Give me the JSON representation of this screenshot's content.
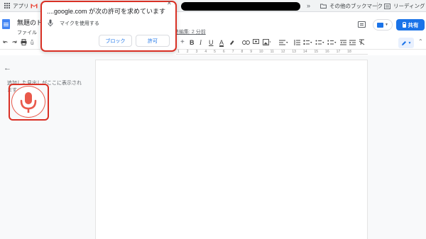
{
  "bookmarks": {
    "apps_label": "アプリ",
    "chevron": "»",
    "other_bookmarks": "その他のブックマーク",
    "reading_list": "リーディング"
  },
  "doc": {
    "title": "無題のド",
    "menu_file": "ファイル",
    "last_edit": "最終編集: 2 分前",
    "share_label": "共有"
  },
  "toolbar": {
    "bold": "B",
    "italic": "I",
    "underline": "U",
    "text_color": "A"
  },
  "ruler": {
    "ticks": [
      "1",
      "2",
      "3",
      "4",
      "5",
      "6",
      "7",
      "8",
      "9",
      "10",
      "11",
      "12",
      "13",
      "14",
      "15",
      "16",
      "17",
      "18"
    ]
  },
  "outline": {
    "text": "追加した見出しがここに表示されます"
  },
  "permission": {
    "title": "....google.com が次の許可を求めています",
    "request": "マイクを使用する",
    "block_label": "ブロック",
    "allow_label": "許可"
  },
  "colors": {
    "accent": "#1a73e8",
    "highlight": "#d93025",
    "mic": "#e9594b"
  }
}
